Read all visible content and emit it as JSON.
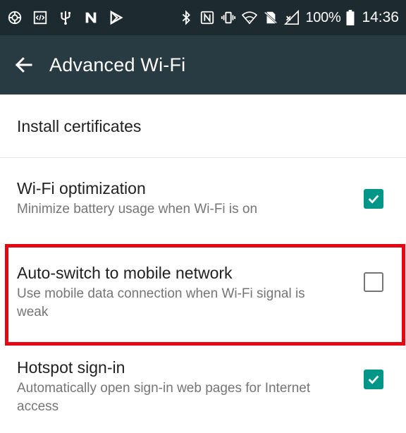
{
  "status_bar": {
    "icons_left": [
      "settings-app-icon",
      "code-icon",
      "usb-icon",
      "n-icon",
      "play-store-icon"
    ],
    "icons_right": [
      "bluetooth-icon",
      "nfc-icon",
      "vibrate-icon",
      "wifi-icon",
      "no-sim-icon",
      "no-signal-icon"
    ],
    "battery_percent": "100%",
    "time": "14:36"
  },
  "app_bar": {
    "title": "Advanced Wi-Fi",
    "back_icon": "arrow-back-icon"
  },
  "items": [
    {
      "title": "Install certificates"
    },
    {
      "title": "Wi-Fi optimization",
      "summary": "Minimize battery usage when Wi-Fi is on",
      "checked": true
    },
    {
      "title": "Auto-switch to mobile network",
      "summary": "Use mobile data connection when Wi-Fi signal is weak",
      "checked": false
    },
    {
      "title": "Hotspot sign-in",
      "summary": "Automatically open sign-in web pages for Internet access",
      "checked": true
    }
  ],
  "colors": {
    "status_bar": "#1d2a30",
    "app_bar": "#283a42",
    "checkbox_accent": "#009688",
    "highlight_border": "#e30613"
  }
}
